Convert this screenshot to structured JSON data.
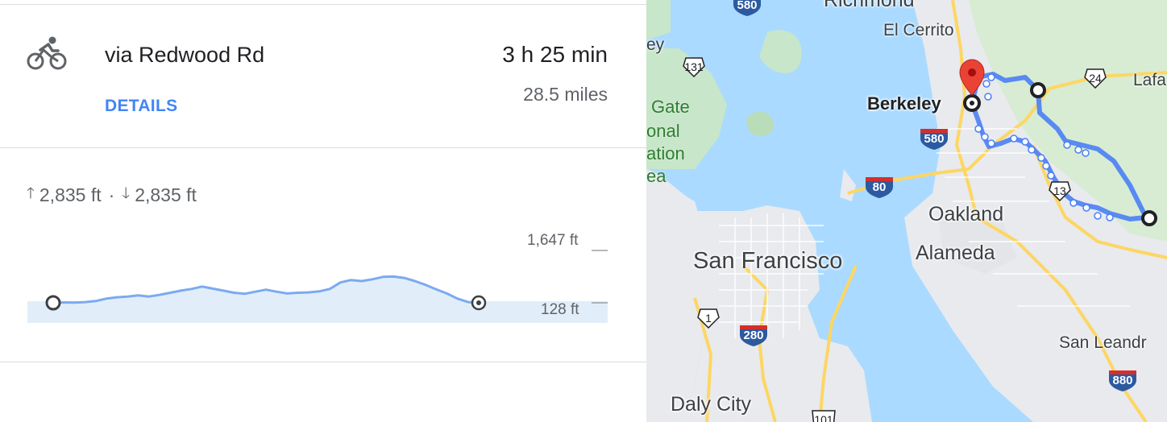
{
  "route": {
    "via": "via Redwood Rd",
    "details_label": "DETAILS",
    "duration": "3 h 25 min",
    "distance": "28.5 miles",
    "mode_icon": "bicycle-icon"
  },
  "elevation": {
    "ascent": "2,835 ft",
    "descent": "2,835 ft",
    "separator": "·",
    "max_label": "1,647 ft",
    "min_label": "128 ft",
    "max_ft": 1647,
    "min_ft": 128,
    "profile_ft": [
      128,
      140,
      135,
      150,
      180,
      250,
      290,
      310,
      345,
      310,
      360,
      420,
      480,
      530,
      600,
      540,
      480,
      420,
      390,
      450,
      510,
      450,
      400,
      420,
      430,
      460,
      530,
      720,
      790,
      760,
      810,
      880,
      890,
      850,
      760,
      650,
      520,
      400,
      250,
      150,
      128
    ]
  },
  "map": {
    "labels": {
      "richmond": "Richmond",
      "el_cerrito": "El Cerrito",
      "berkeley": "Berkeley",
      "oakland": "Oakland",
      "alameda": "Alameda",
      "san_francisco": "San Francisco",
      "daly_city": "Daly City",
      "san_leandro": "San Leandr",
      "lafayette": "Lafa",
      "golden_gate_1": "Gate",
      "golden_gate_2": "onal",
      "golden_gate_3": "ation",
      "golden_gate_4": "ea",
      "fragment_top": "ey"
    },
    "shields": {
      "i580_top": "580",
      "i580": "580",
      "i80": "80",
      "i280": "280",
      "i880": "880",
      "us101": "101",
      "ca131": "131",
      "ca24": "24",
      "ca13": "13",
      "ca1": "1"
    },
    "colors": {
      "water": "#aadaff",
      "land": "#e8eaed",
      "park": "#c8e6c9",
      "route": "#4a80f5",
      "pin": "#ea4335",
      "interstate": "#2c5aa0"
    }
  }
}
